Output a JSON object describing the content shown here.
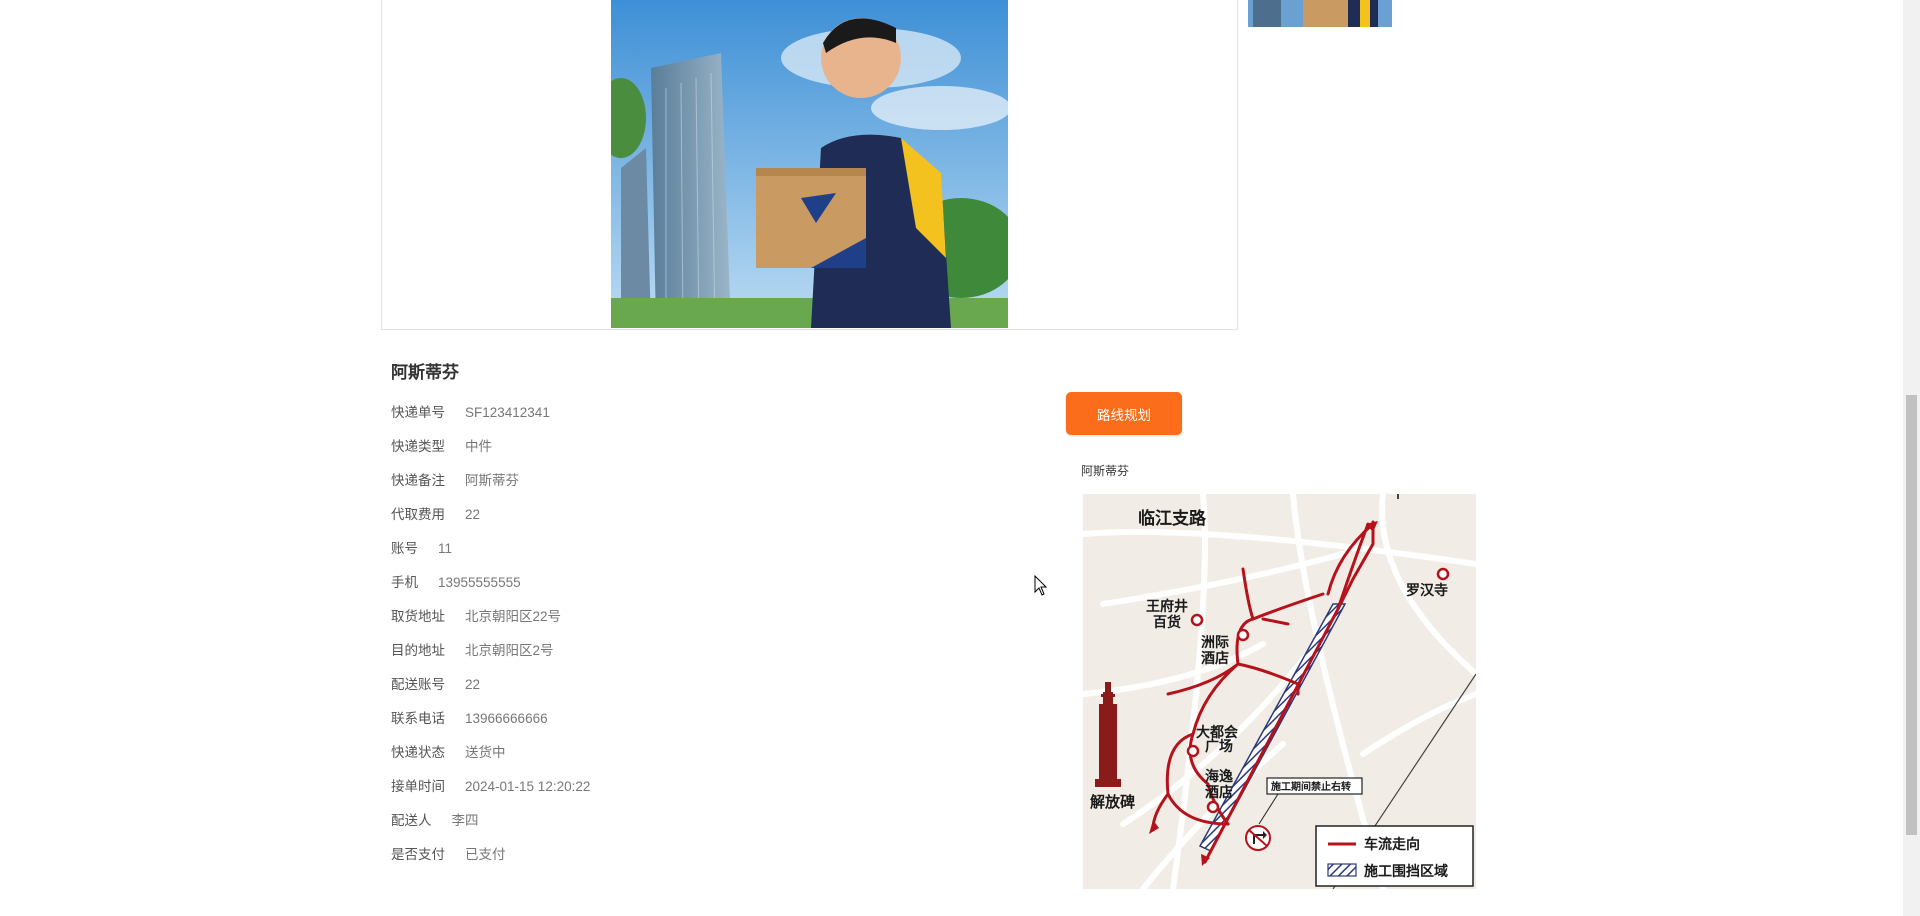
{
  "detail": {
    "title": "阿斯蒂芬",
    "rows": [
      {
        "label": "快递单号",
        "value": "SF123412341"
      },
      {
        "label": "快递类型",
        "value": "中件"
      },
      {
        "label": "快递备注",
        "value": "阿斯蒂芬"
      },
      {
        "label": "代取费用",
        "value": "22"
      },
      {
        "label": "账号",
        "value": "11"
      },
      {
        "label": "手机",
        "value": "13955555555"
      },
      {
        "label": "取货地址",
        "value": "北京朝阳区22号"
      },
      {
        "label": "目的地址",
        "value": "北京朝阳区2号"
      },
      {
        "label": "配送账号",
        "value": "22"
      },
      {
        "label": "联系电话",
        "value": "13966666666"
      },
      {
        "label": "快递状态",
        "value": "送货中"
      },
      {
        "label": "接单时间",
        "value": "2024-01-15 12:20:22"
      },
      {
        "label": "配送人",
        "value": "李四"
      },
      {
        "label": "是否支付",
        "value": "已支付"
      }
    ]
  },
  "route_button": {
    "label": "路线规划"
  },
  "map": {
    "caption": "阿斯蒂芬",
    "labels": {
      "road": "临江支路",
      "wangfujing": "王府井\n百货",
      "zhouji": "洲际\n酒店",
      "luohan": "罗汉寺",
      "dadu": "大都会\n广场",
      "haiyi": "海逸\n酒店",
      "jiefangbei": "解放碑",
      "no_turn": "施工期间禁止右转"
    },
    "legend": {
      "traffic": "车流走向",
      "construction": "施工围挡区域"
    },
    "colors": {
      "route": "#b5121b",
      "background": "#f1ede6",
      "hatch": "#2b3a7a"
    }
  },
  "colors": {
    "button": "#fb6c1b",
    "frame_border": "#e2e2e2"
  }
}
